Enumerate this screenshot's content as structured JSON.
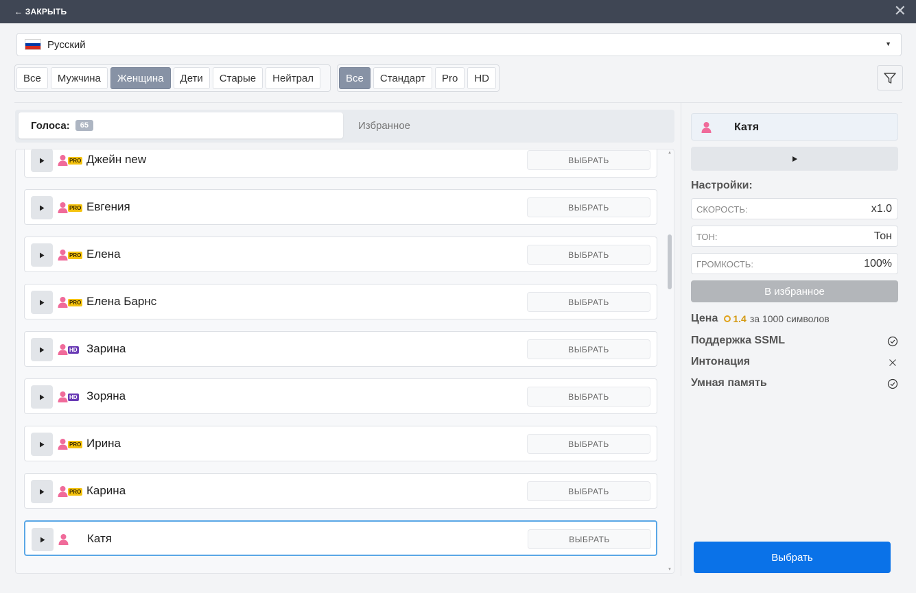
{
  "header": {
    "close_label": "← ЗАКРЫТЬ",
    "close_icon": "close-icon"
  },
  "language": {
    "selected": "Русский",
    "flag_colors": [
      "#ffffff",
      "#0039a6",
      "#d52b1e"
    ]
  },
  "filters": {
    "gender": [
      {
        "label": "Все",
        "active": false
      },
      {
        "label": "Мужчина",
        "active": false
      },
      {
        "label": "Женщина",
        "active": true
      },
      {
        "label": "Дети",
        "active": false
      },
      {
        "label": "Старые",
        "active": false
      },
      {
        "label": "Нейтрал",
        "active": false
      }
    ],
    "tier": [
      {
        "label": "Все",
        "active": true
      },
      {
        "label": "Стандарт",
        "active": false
      },
      {
        "label": "Pro",
        "active": false
      },
      {
        "label": "HD",
        "active": false
      }
    ]
  },
  "tabs": {
    "voices_label": "Голоса:",
    "voices_count": "65",
    "favorites_label": "Избранное"
  },
  "voices": [
    {
      "name": "Джейн new",
      "tier": "PRO",
      "select_label": "ВЫБРАТЬ",
      "selected": false
    },
    {
      "name": "Евгения",
      "tier": "PRO",
      "select_label": "ВЫБРАТЬ",
      "selected": false
    },
    {
      "name": "Елена",
      "tier": "PRO",
      "select_label": "ВЫБРАТЬ",
      "selected": false
    },
    {
      "name": "Елена Барнс",
      "tier": "PRO",
      "select_label": "ВЫБРАТЬ",
      "selected": false
    },
    {
      "name": "Зарина",
      "tier": "HD",
      "select_label": "ВЫБРАТЬ",
      "selected": false
    },
    {
      "name": "Зоряна",
      "tier": "HD",
      "select_label": "ВЫБРАТЬ",
      "selected": false
    },
    {
      "name": "Ирина",
      "tier": "PRO",
      "select_label": "ВЫБРАТЬ",
      "selected": false
    },
    {
      "name": "Карина",
      "tier": "PRO",
      "select_label": "ВЫБРАТЬ",
      "selected": false
    },
    {
      "name": "Катя",
      "tier": "",
      "select_label": "ВЫБРАТЬ",
      "selected": true
    }
  ],
  "panel": {
    "voice_name": "Катя",
    "settings_title": "Настройки:",
    "speed_label": "СКОРОСТЬ:",
    "speed_value": "x1.0",
    "tone_label": "ТОН:",
    "tone_value": "Тон",
    "volume_label": "ГРОМКОСТЬ:",
    "volume_value": "100%",
    "favorite_button": "В избранное",
    "price_label": "Цена",
    "price_value": "1.4",
    "price_unit": "за 1000 символов",
    "features": [
      {
        "label": "Поддержка SSML",
        "supported": true
      },
      {
        "label": "Интонация",
        "supported": false
      },
      {
        "label": "Умная память",
        "supported": true
      }
    ],
    "select_button": "Выбрать"
  },
  "colors": {
    "accent": "#0a72e8",
    "female_icon": "#f06b9a",
    "pro_badge": "#f4c20d",
    "hd_badge": "#6a3bb5",
    "selected_border": "#5aa7e6"
  }
}
